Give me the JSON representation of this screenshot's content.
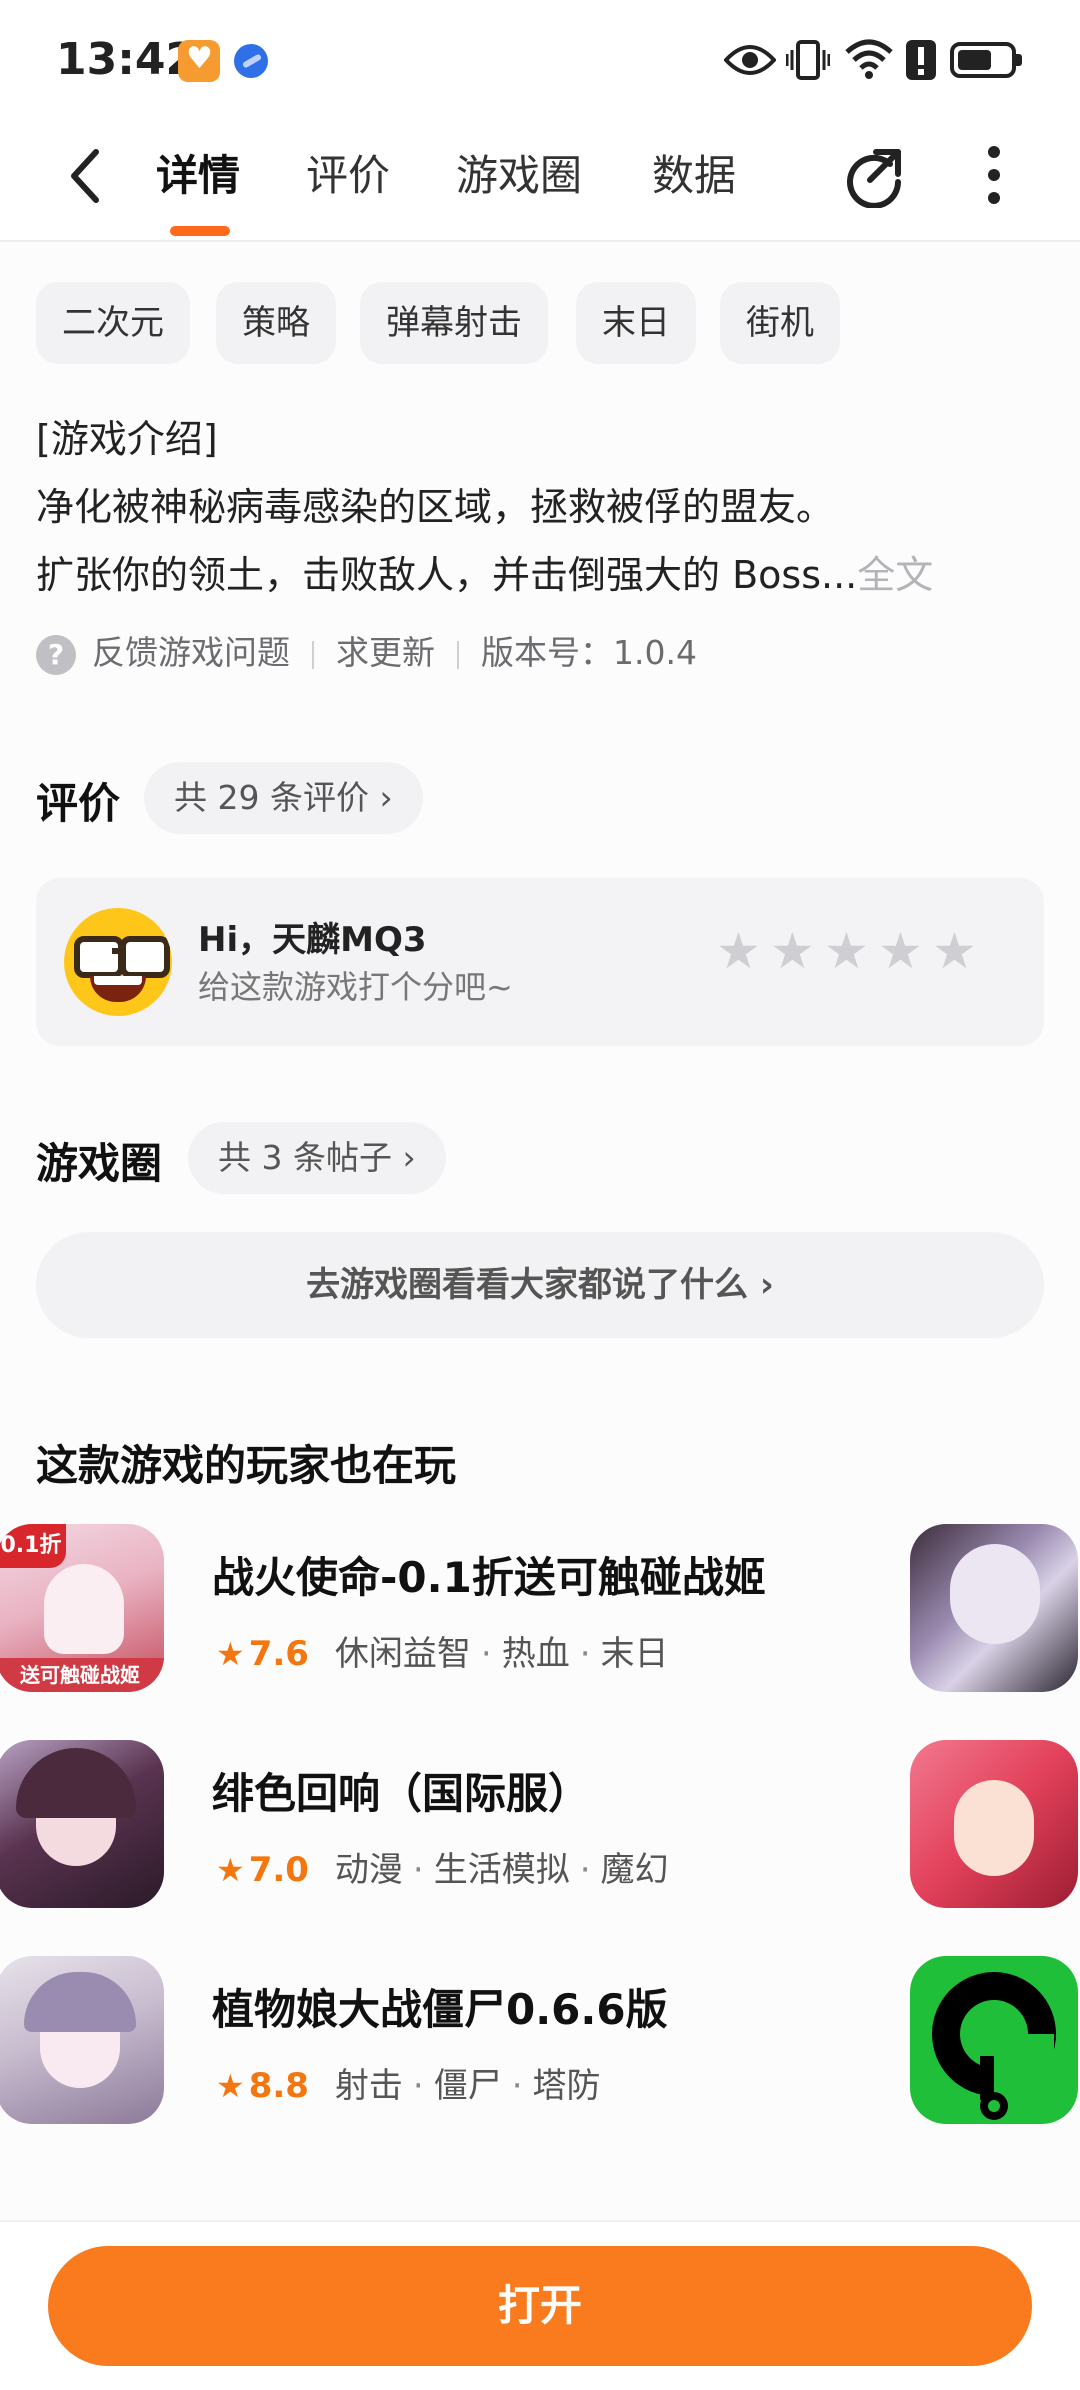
{
  "status_bar": {
    "time": "13:42",
    "battery_level": 0.65
  },
  "header": {
    "tabs": [
      {
        "label": "详情",
        "active": true
      },
      {
        "label": "评价",
        "active": false
      },
      {
        "label": "游戏圈",
        "active": false
      },
      {
        "label": "数据",
        "active": false
      }
    ],
    "accent_color": "#ff6a1a"
  },
  "tags": [
    "二次元",
    "策略",
    "弹幕射击",
    "末日",
    "街机"
  ],
  "intro": {
    "heading": "[游戏介绍]",
    "line1": "净化被神秘病毒感染的区域，拯救被俘的盟友。",
    "line2": "扩张你的领土，击败敌人，并击倒强大的 Boss...",
    "more": "全文"
  },
  "meta": {
    "feedback": "反馈游戏问题",
    "request_update": "求更新",
    "version": "版本号：1.0.4"
  },
  "reviews": {
    "title": "评价",
    "count_label": "共 29 条评价 ›",
    "greeting": "Hi，天麟MQ3",
    "prompt": "给这款游戏打个分吧~",
    "stars": 0
  },
  "circle": {
    "title": "游戏圈",
    "count_label": "共 3 条帖子 ›",
    "cta": "去游戏圈看看大家都说了什么 ›"
  },
  "recommend": {
    "title": "这款游戏的玩家也在玩",
    "items": [
      {
        "name": "战火使命-0.1折送可触碰战姬",
        "score": "7.6",
        "tags": [
          "休闲益智",
          "热血",
          "末日"
        ],
        "icon_badge": "0.1折",
        "icon_caption": "送可触碰战姬"
      },
      {
        "name": "绯色回响（国际服）",
        "score": "7.0",
        "tags": [
          "动漫",
          "生活模拟",
          "魔幻"
        ]
      },
      {
        "name": "植物娘大战僵尸0.6.6版",
        "score": "8.8",
        "tags": [
          "射击",
          "僵尸",
          "塔防"
        ]
      }
    ]
  },
  "bottom": {
    "open_label": "打开",
    "button_color": "#fa7a1e"
  }
}
